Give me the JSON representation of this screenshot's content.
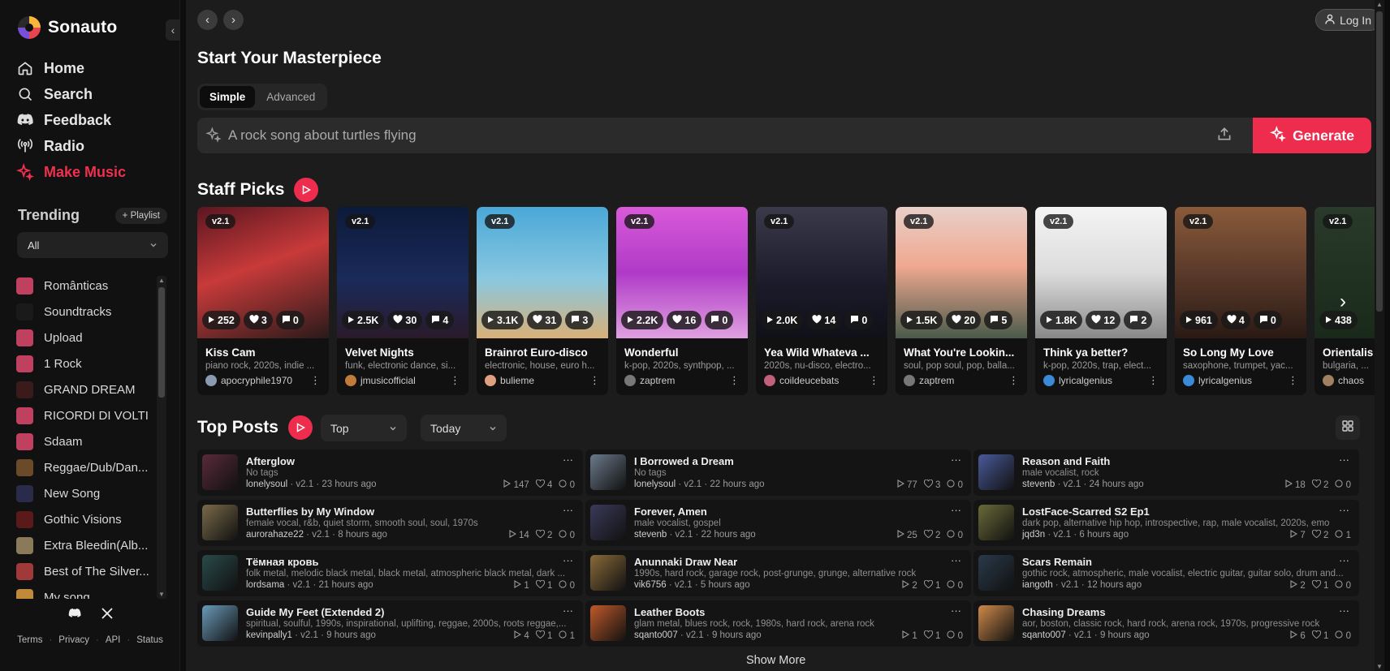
{
  "brand": {
    "name": "Sonauto"
  },
  "nav": [
    {
      "label": "Home",
      "icon": "home-icon"
    },
    {
      "label": "Search",
      "icon": "search-icon"
    },
    {
      "label": "Feedback",
      "icon": "discord-icon"
    },
    {
      "label": "Radio",
      "icon": "radio-icon"
    },
    {
      "label": "Make Music",
      "icon": "sparkle-icon"
    }
  ],
  "trending": {
    "title": "Trending",
    "playlist_button": "+ Playlist",
    "filter": "All"
  },
  "playlists": [
    {
      "label": "Românticas",
      "color": "#c0415f"
    },
    {
      "label": "Soundtracks",
      "color": "#1a1a1a"
    },
    {
      "label": "Upload",
      "color": "#c0415f"
    },
    {
      "label": "1 Rock",
      "color": "#c0415f"
    },
    {
      "label": "GRAND DREAM",
      "color": "#3a1a1a"
    },
    {
      "label": "RICORDI DI VOLTI",
      "color": "#c0415f"
    },
    {
      "label": "Sdaam",
      "color": "#c0415f"
    },
    {
      "label": "Reggae/Dub/Dan...",
      "color": "#6b4a2a"
    },
    {
      "label": "New Song",
      "color": "#2a2a4a"
    },
    {
      "label": "Gothic Visions",
      "color": "#5a1a1a"
    },
    {
      "label": "Extra Bleedin(Alb...",
      "color": "#8a7a5a"
    },
    {
      "label": "Best of The Silver...",
      "color": "#a03a3a"
    },
    {
      "label": "My song",
      "color": "#c08a3a"
    }
  ],
  "footer": {
    "terms": "Terms",
    "privacy": "Privacy",
    "api": "API",
    "status": "Status"
  },
  "header": {
    "login": "Log In"
  },
  "create": {
    "title": "Start Your Masterpiece",
    "tabs": [
      "Simple",
      "Advanced"
    ],
    "prompt_placeholder": "A rock song about turtles flying",
    "generate": "Generate"
  },
  "staff_picks": {
    "title": "Staff Picks",
    "cards": [
      {
        "version": "v2.1",
        "plays": "252",
        "likes": "3",
        "comments": "0",
        "title": "Kiss Cam",
        "tags": "piano rock, 2020s, indie ...",
        "user": "apocryphile1970",
        "bg": "linear-gradient(160deg,#5a1620,#c83a3a 45%,#2a1a1a)",
        "avatar": "#8a9ab0"
      },
      {
        "version": "v2.1",
        "plays": "2.5K",
        "likes": "30",
        "comments": "4",
        "title": "Velvet Nights",
        "tags": "funk, electronic dance, si...",
        "user": "jmusicofficial",
        "bg": "linear-gradient(180deg,#0c1a3a,#1a2a5a 55%,#2a1a2a)",
        "avatar": "#c07a3a"
      },
      {
        "version": "v2.1",
        "plays": "3.1K",
        "likes": "31",
        "comments": "3",
        "title": "Brainrot Euro-disco",
        "tags": "electronic, house, euro h...",
        "user": "bulieme",
        "bg": "linear-gradient(180deg,#4aa8d8,#8ac8e0 55%,#d8b078)",
        "avatar": "#e0a080"
      },
      {
        "version": "v2.1",
        "plays": "2.2K",
        "likes": "16",
        "comments": "0",
        "title": "Wonderful",
        "tags": "k-pop, 2020s, synthpop, ...",
        "user": "zaptrem",
        "bg": "linear-gradient(180deg,#d85ad8,#b03ac8 50%,#e0a0e0)",
        "avatar": "#777"
      },
      {
        "version": "v2.1",
        "plays": "2.0K",
        "likes": "14",
        "comments": "0",
        "title": "Yea Wild Whateva ...",
        "tags": "2020s, nu-disco, electro...",
        "user": "coildeucebats",
        "bg": "linear-gradient(180deg,#3a3a4a,#1a1a2a 60%,#101018)",
        "avatar": "#c0607a"
      },
      {
        "version": "v2.1",
        "plays": "1.5K",
        "likes": "20",
        "comments": "5",
        "title": "What You're Lookin...",
        "tags": "soul, pop soul, pop, balla...",
        "user": "zaptrem",
        "bg": "linear-gradient(180deg,#e8d0c8,#f0a890 45%,#4a5a4a)",
        "avatar": "#777"
      },
      {
        "version": "v2.1",
        "plays": "1.8K",
        "likes": "12",
        "comments": "2",
        "title": "Think ya better?",
        "tags": "k-pop, 2020s, trap, elect...",
        "user": "lyricalgenius",
        "bg": "linear-gradient(180deg,#f4f4f4,#dcdcdc 50%,#888)",
        "avatar": "#3a8ad8"
      },
      {
        "version": "v2.1",
        "plays": "961",
        "likes": "4",
        "comments": "0",
        "title": "So Long My Love",
        "tags": "saxophone, trumpet, yac...",
        "user": "lyricalgenius",
        "bg": "linear-gradient(180deg,#8a5a3a,#5a3a2a 50%,#2a1a14)",
        "avatar": "#3a8ad8"
      },
      {
        "version": "v2.1",
        "plays": "438",
        "likes": "",
        "comments": "",
        "title": "Orientalis",
        "tags": "bulgaria, ...",
        "user": "chaos",
        "bg": "linear-gradient(180deg,#2a3a2a,#1a2a1a)",
        "avatar": "#a08060"
      }
    ]
  },
  "top_posts": {
    "title": "Top Posts",
    "sort": "Top",
    "range": "Today",
    "show_more": "Show More",
    "posts": [
      {
        "title": "Afterglow",
        "tags": "No tags",
        "user": "lonelysoul",
        "version": "v2.1",
        "time": "23 hours ago",
        "plays": "147",
        "likes": "4",
        "comments": "0",
        "color": "#5a2a3a"
      },
      {
        "title": "I Borrowed a Dream",
        "tags": "No tags",
        "user": "lonelysoul",
        "version": "v2.1",
        "time": "22 hours ago",
        "plays": "77",
        "likes": "3",
        "comments": "0",
        "color": "#6a7a8a"
      },
      {
        "title": "Reason and Faith",
        "tags": "male vocalist, rock",
        "user": "stevenb",
        "version": "v2.1",
        "time": "24 hours ago",
        "plays": "18",
        "likes": "2",
        "comments": "0",
        "color": "#4a5a9a"
      },
      {
        "title": "Butterflies by My Window",
        "tags": "female vocal, r&b, quiet storm, smooth soul, soul, 1970s",
        "user": "aurorahaze22",
        "version": "v2.1",
        "time": "8 hours ago",
        "plays": "14",
        "likes": "2",
        "comments": "0",
        "color": "#7a6a4a"
      },
      {
        "title": "Forever, Amen",
        "tags": "male vocalist, gospel",
        "user": "stevenb",
        "version": "v2.1",
        "time": "22 hours ago",
        "plays": "25",
        "likes": "2",
        "comments": "0",
        "color": "#3a3a5a"
      },
      {
        "title": "LostFace-Scarred S2 Ep1",
        "tags": "dark pop, alternative hip hop, introspective, rap, male vocalist, 2020s, emo",
        "user": "jqd3n",
        "version": "v2.1",
        "time": "6 hours ago",
        "plays": "7",
        "likes": "2",
        "comments": "1",
        "color": "#6a6a3a"
      },
      {
        "title": "Тёмная кровь",
        "tags": "folk metal, melodic black metal, black metal, atmospheric black metal, dark ...",
        "user": "lordsama",
        "version": "v2.1",
        "time": "21 hours ago",
        "plays": "1",
        "likes": "1",
        "comments": "0",
        "color": "#2a4a4a"
      },
      {
        "title": "Anunnaki Draw Near",
        "tags": "1990s, hard rock, garage rock, post-grunge, grunge, alternative rock",
        "user": "vik6756",
        "version": "v2.1",
        "time": "5 hours ago",
        "plays": "2",
        "likes": "1",
        "comments": "0",
        "color": "#8a6a3a"
      },
      {
        "title": "Scars Remain",
        "tags": "gothic rock, atmospheric, male vocalist, electric guitar, guitar solo, drum and...",
        "user": "iangoth",
        "version": "v2.1",
        "time": "12 hours ago",
        "plays": "2",
        "likes": "1",
        "comments": "0",
        "color": "#2a3a4a"
      },
      {
        "title": "Guide My Feet (Extended 2)",
        "tags": "spiritual, soulful, 1990s, inspirational, uplifting, reggae, 2000s, roots reggae,...",
        "user": "kevinpally1",
        "version": "v2.1",
        "time": "9 hours ago",
        "plays": "4",
        "likes": "1",
        "comments": "1",
        "color": "#6a9aba"
      },
      {
        "title": "Leather Boots",
        "tags": "glam metal, blues rock, rock, 1980s, hard rock, arena rock",
        "user": "sqanto007",
        "version": "v2.1",
        "time": "9 hours ago",
        "plays": "1",
        "likes": "1",
        "comments": "0",
        "color": "#c05a2a"
      },
      {
        "title": "Chasing Dreams",
        "tags": "aor, boston, classic rock, hard rock, arena rock, 1970s, progressive rock",
        "user": "sqanto007",
        "version": "v2.1",
        "time": "9 hours ago",
        "plays": "6",
        "likes": "1",
        "comments": "0",
        "color": "#d08a4a"
      }
    ]
  }
}
